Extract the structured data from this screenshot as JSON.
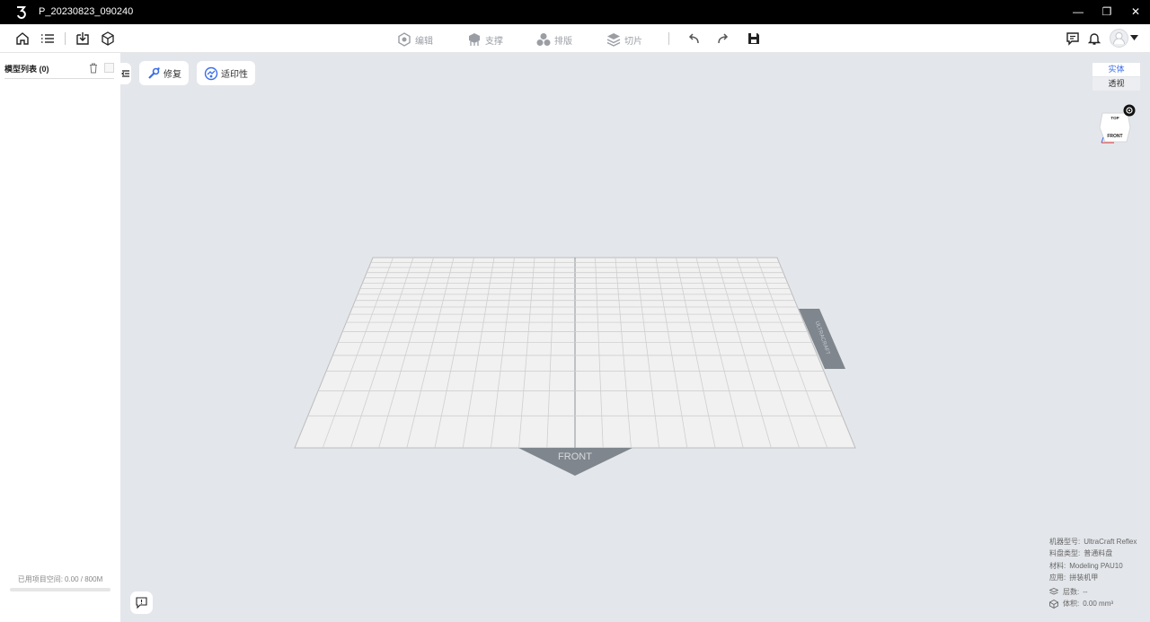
{
  "window": {
    "title": "P_20230823_090240",
    "minimize": "—",
    "restore": "❐",
    "close": "✕"
  },
  "toolbar": {
    "left_icons": [
      "home-icon",
      "list-icon",
      "import-icon",
      "model-icon"
    ],
    "modes": [
      {
        "id": "edit",
        "label": "编辑",
        "icon": "hex-icon"
      },
      {
        "id": "support",
        "label": "支撑",
        "icon": "support-icon"
      },
      {
        "id": "layout",
        "label": "排版",
        "icon": "layout-icon"
      },
      {
        "id": "slice",
        "label": "切片",
        "icon": "layers-icon"
      }
    ],
    "right_icons": [
      "message-icon",
      "bell-icon",
      "avatar",
      "chevron-down-icon"
    ]
  },
  "sidebar": {
    "header": "模型列表 (0)",
    "used_label": "已用项目空间:",
    "used_value": "0.00 / 800M",
    "used_fraction": 0
  },
  "actions": {
    "repair": "修复",
    "printability": "适印性"
  },
  "view_tabs": {
    "solid": "实体",
    "perspective": "透视"
  },
  "view_cube": {
    "top": "TOP",
    "front": "FRONT"
  },
  "build_plate": {
    "front_label": "FRONT",
    "side_label": "ULTRACRAFT"
  },
  "info": {
    "machine_label": "机器型号:",
    "machine_value": "UltraCraft Reflex",
    "tray_label": "料盘类型:",
    "tray_value": "普通料盘",
    "material_label": "材料:",
    "material_value": "Modeling PAU10",
    "app_label": "应用:",
    "app_value": "拼装机甲",
    "layers_label": "层数:",
    "layers_value": "--",
    "volume_label": "体积:",
    "volume_value": "0.00 mm³"
  },
  "colors": {
    "accent": "#3a6ee8",
    "viewport_bg": "#e3e6ea",
    "plate": "#f1f1f1",
    "grid": "#cfcfcf",
    "front_tab": "#7f868d"
  }
}
